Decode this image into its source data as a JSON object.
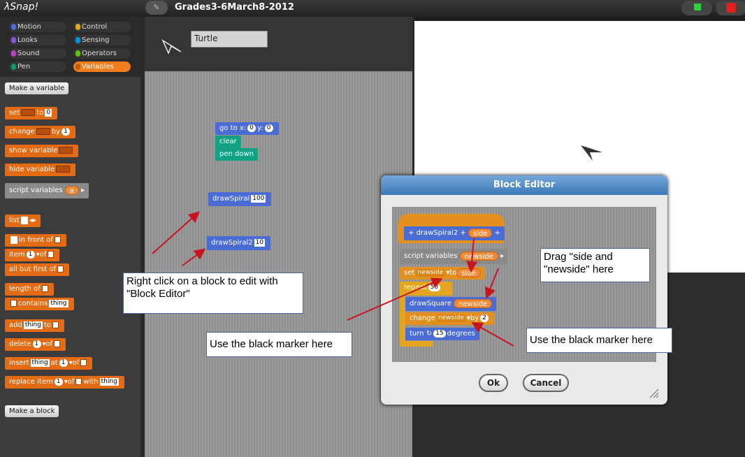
{
  "app": {
    "logo": "Snap!",
    "project_title": "Grades3-6March8-2012",
    "edit_icon": "pencil-icon"
  },
  "categories": [
    {
      "label": "Motion",
      "color": "#4a6cd4"
    },
    {
      "label": "Control",
      "color": "#e6a822"
    },
    {
      "label": "Looks",
      "color": "#8a55d7"
    },
    {
      "label": "Sensing",
      "color": "#0094dd"
    },
    {
      "label": "Sound",
      "color": "#bb42c3"
    },
    {
      "label": "Operators",
      "color": "#62c213"
    },
    {
      "label": "Pen",
      "color": "#0e9a6c"
    },
    {
      "label": "Variables",
      "color": "#f3761d"
    }
  ],
  "palette": {
    "make_variable": "Make a variable",
    "set": "set",
    "to": "to",
    "set_value": "0",
    "change": "change",
    "by": "by",
    "change_value": "1",
    "show_variable": "show variable",
    "hide_variable": "hide variable",
    "script_variables": "script variables",
    "script_var_a": "a",
    "list": "list",
    "in_front_of": "in front of",
    "item": "item",
    "item_index": "1",
    "of": "of",
    "all_but_first_of": "all but first of",
    "length_of": "length of",
    "contains": "contains",
    "thing": "thing",
    "add": "add",
    "delete": "delete",
    "insert": "insert",
    "at": "at",
    "replace_item": "replace item",
    "with": "with",
    "make_block": "Make a block"
  },
  "sprite": {
    "name": "Turtle"
  },
  "scripts": {
    "goto_label": "go to x:",
    "goto_x": "0",
    "goto_y_label": "y:",
    "goto_y": "0",
    "clear": "clear",
    "pen_down": "pen down",
    "draw_spiral": "drawSpiral",
    "draw_spiral_arg": "100",
    "draw_spiral2": "drawSpiral2",
    "draw_spiral2_arg": "10"
  },
  "block_editor": {
    "title": "Block Editor",
    "proto_name": "drawSpiral2",
    "proto_param": "side",
    "script_variables": "script variables",
    "script_var": "newside",
    "set": "set",
    "set_var": "newside",
    "to": "to",
    "set_value": "side",
    "repeat": "repeat",
    "repeat_count": "50",
    "draw_square": "drawSquare",
    "draw_square_arg": "newside",
    "change": "change",
    "change_var": "newside",
    "by": "by",
    "change_value": "2",
    "turn": "turn",
    "turn_value": "15",
    "degrees": "degrees",
    "ok": "Ok",
    "cancel": "Cancel"
  },
  "callouts": {
    "right_click": "Right click on a block to edit with \"Block Editor\"",
    "drag_side": "Drag \"side and \"newside\" here",
    "marker_left": "Use the black marker here",
    "marker_right": "Use the black marker here"
  }
}
